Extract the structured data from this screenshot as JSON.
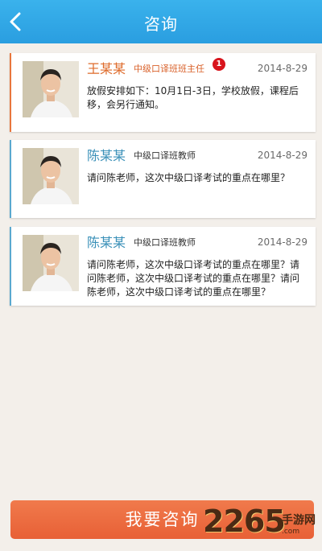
{
  "header": {
    "title": "咨询",
    "back_icon": "chevron-left-icon"
  },
  "messages": [
    {
      "name": "王某某",
      "role": "中级口译班班主任",
      "badge": "1",
      "date": "2014-8-29",
      "text": "放假安排如下：10月1日-3日，学校放假，课程后移，会另行通知。"
    },
    {
      "name": "陈某某",
      "role": "中级口译班教师",
      "date": "2014-8-29",
      "text": "请问陈老师，这次中级口译考试的重点在哪里？"
    },
    {
      "name": "陈某某",
      "role": "中级口译班教师",
      "date": "2014-8-29",
      "text": "请问陈老师，这次中级口译考试的重点在哪里？请问陈老师，这次中级口译考试的重点在哪里？请问陈老师，这次中级口译考试的重点在哪里？"
    }
  ],
  "cta": {
    "label": "我要咨询"
  },
  "watermark": {
    "number": "2265",
    "text": ".com",
    "cn": "手游网"
  },
  "colors": {
    "header": "#2a9ee0",
    "accent": "#e86036",
    "badge": "#d8141c"
  }
}
